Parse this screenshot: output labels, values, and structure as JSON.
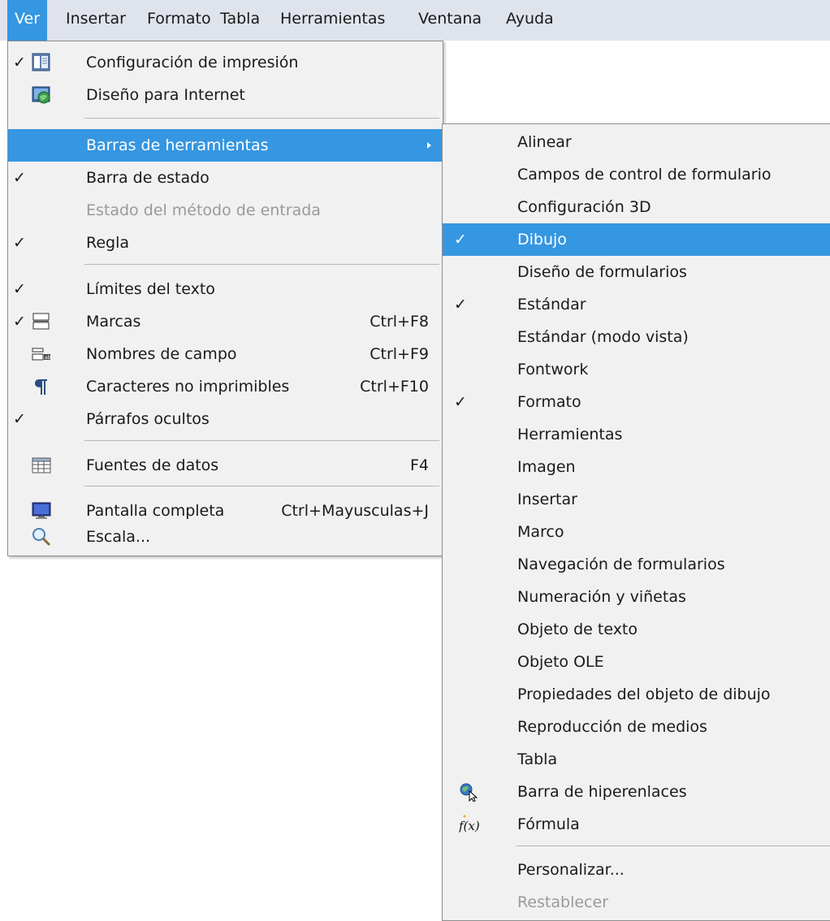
{
  "menubar": {
    "items": [
      {
        "label": "Ver",
        "active": true
      },
      {
        "label": "Insertar"
      },
      {
        "label": "Formato"
      },
      {
        "label": "Tabla"
      },
      {
        "label": "Herramientas"
      },
      {
        "label": "Ventana"
      },
      {
        "label": "Ayuda"
      }
    ]
  },
  "view_menu": {
    "items": [
      {
        "label": "Configuración de impresión",
        "checked": true,
        "icon": "print-layout-icon"
      },
      {
        "label": "Diseño para Internet",
        "icon": "web-layout-icon"
      },
      {
        "label": "Barras de herramientas",
        "highlighted": true,
        "submenu": true
      },
      {
        "label": "Barra de estado",
        "checked": true
      },
      {
        "label": "Estado del método de entrada",
        "disabled": true
      },
      {
        "label": "Regla",
        "checked": true
      },
      {
        "label": "Límites del texto",
        "checked": true
      },
      {
        "label": "Marcas",
        "checked": true,
        "icon": "field-shadings-icon",
        "shortcut": "Ctrl+F8"
      },
      {
        "label": "Nombres de campo",
        "icon": "field-names-icon",
        "shortcut": "Ctrl+F9"
      },
      {
        "label": "Caracteres no imprimibles",
        "icon": "pilcrow-icon",
        "shortcut": "Ctrl+F10"
      },
      {
        "label": "Párrafos ocultos",
        "checked": true
      },
      {
        "label": "Fuentes de datos",
        "icon": "data-sources-icon",
        "shortcut": "F4"
      },
      {
        "label": "Pantalla completa",
        "icon": "monitor-icon",
        "shortcut": "Ctrl+Mayusculas+J"
      },
      {
        "label": "Escala...",
        "icon": "magnifier-icon"
      }
    ]
  },
  "toolbars_submenu": {
    "items": [
      {
        "label": "Alinear"
      },
      {
        "label": "Campos de control de formulario"
      },
      {
        "label": "Configuración 3D"
      },
      {
        "label": "Dibujo",
        "checked": true,
        "highlighted": true
      },
      {
        "label": "Diseño de formularios"
      },
      {
        "label": "Estándar",
        "checked": true
      },
      {
        "label": "Estándar (modo vista)"
      },
      {
        "label": "Fontwork"
      },
      {
        "label": "Formato",
        "checked": true
      },
      {
        "label": "Herramientas"
      },
      {
        "label": "Imagen"
      },
      {
        "label": "Insertar"
      },
      {
        "label": "Marco"
      },
      {
        "label": "Navegación de formularios"
      },
      {
        "label": "Numeración y viñetas"
      },
      {
        "label": "Objeto de texto"
      },
      {
        "label": "Objeto OLE"
      },
      {
        "label": "Propiedades del objeto de dibujo"
      },
      {
        "label": "Reproducción de medios"
      },
      {
        "label": "Tabla"
      },
      {
        "label": "Barra de hiperenlaces",
        "icon": "hyperlink-bar-icon"
      },
      {
        "label": "Fórmula",
        "icon": "formula-icon"
      },
      {
        "label": "Personalizar..."
      },
      {
        "label": "Restablecer",
        "disabled": true
      }
    ]
  },
  "colors": {
    "highlight": "#3596e1",
    "menu_background": "#f1f1f1",
    "menubar_background": "#dfe3ec",
    "disabled_text": "#9a9a9a"
  }
}
